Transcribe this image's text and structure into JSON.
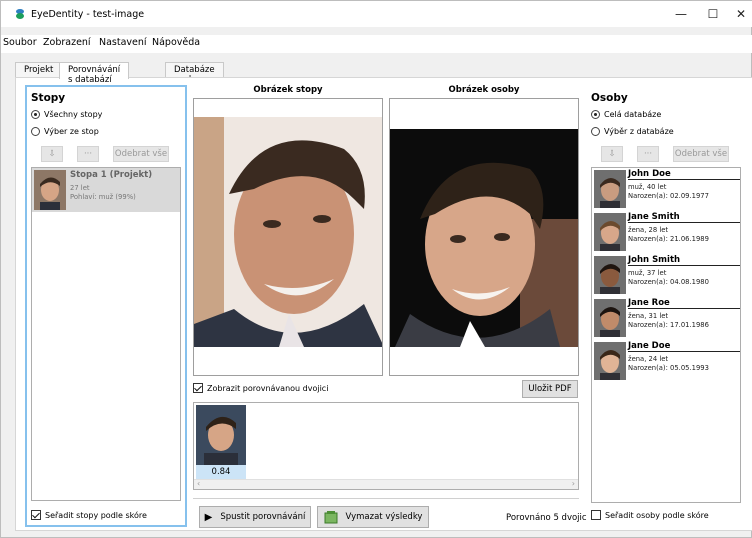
{
  "app": {
    "title": "EyeDentity - test-image"
  },
  "window_controls": {
    "minimize": "—",
    "maximize": "☐",
    "close": "✕"
  },
  "menu": [
    "Soubor",
    "Zobrazení",
    "Nastavení",
    "Nápověda"
  ],
  "tabs": [
    "Projekt",
    "Porovnávání s databází",
    "Databáze osob"
  ],
  "left": {
    "heading": "Stopy",
    "radio_all": "Všechny stopy",
    "radio_select": "Výber ze stop",
    "btn_up": "⇩",
    "btn_dots": "···",
    "btn_remove": "Odebrat vše",
    "item": {
      "name": "Stopa 1 (Projekt)",
      "age": "27 let",
      "gender": "Pohlaví: muž (99%)"
    },
    "sort_label": "Seřadit stopy podle skóre"
  },
  "center": {
    "caption_trace": "Obrázek stopy",
    "caption_person": "Obrázek osoby",
    "show_pair": "Zobrazit porovnávanou dvojici",
    "save_pdf": "Uložit PDF",
    "result_score": "0.84",
    "run": "Spustit porovnávání",
    "clear": "Vymazat výsledky",
    "status": "Porovnáno 5 dvojic"
  },
  "right": {
    "heading": "Osoby",
    "radio_all": "Celá databáze",
    "radio_select": "Výběr z databáze",
    "btn_up": "⇩",
    "btn_dots": "···",
    "btn_remove": "Odebrat vše",
    "persons": [
      {
        "name": "John Doe",
        "l1": "muž, 40 let",
        "l2": "Narozen(a): 02.09.1977",
        "skin": "#c99c80",
        "hair": "#3b2a1f"
      },
      {
        "name": "Jane Smith",
        "l1": "žena, 28 let",
        "l2": "Narozen(a): 21.06.1989",
        "skin": "#d7a78a",
        "hair": "#6b4a2e"
      },
      {
        "name": "John Smith",
        "l1": "muž, 37 let",
        "l2": "Narozen(a): 04.08.1980",
        "skin": "#8a5a3e",
        "hair": "#1f1510"
      },
      {
        "name": "Jane Roe",
        "l1": "žena, 31 let",
        "l2": "Narozen(a): 17.01.1986",
        "skin": "#c08b6a",
        "hair": "#1c1410"
      },
      {
        "name": "Jane Doe",
        "l1": "žena, 24 let",
        "l2": "Narozen(a): 05.05.1993",
        "skin": "#e0b496",
        "hair": "#3a2718"
      }
    ],
    "sort_label": "Seřadit osoby podle skóre"
  },
  "colors": {
    "accent_border": "#86c1ed",
    "selection": "#cce4f7"
  }
}
